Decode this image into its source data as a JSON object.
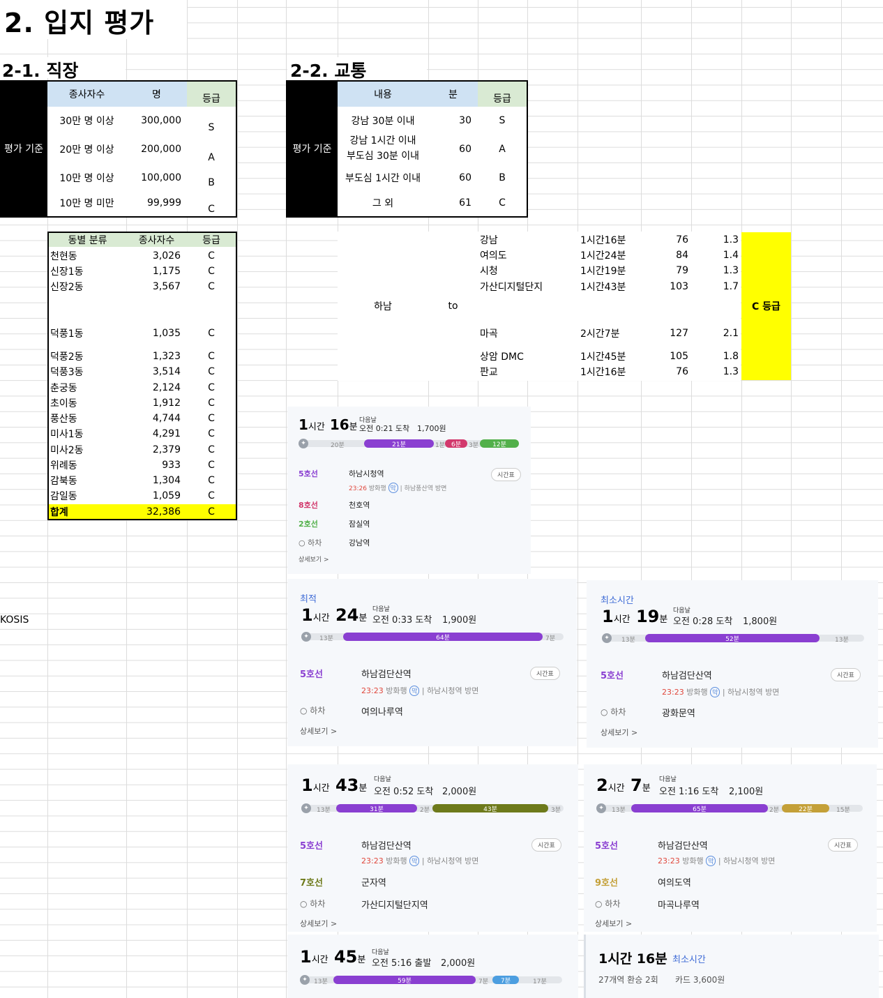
{
  "page_title": "2. 입지 평가",
  "sec1": {
    "title": "2-1. 직장",
    "criteria_label": "평가 기준",
    "headers": [
      "종사자수",
      "명",
      "등급"
    ],
    "rows": [
      {
        "desc": "30만 명 이상",
        "num": "300,000",
        "grade": "S"
      },
      {
        "desc": "20만 명 이상",
        "num": "200,000",
        "grade": "A"
      },
      {
        "desc": "10만 명 이상",
        "num": "100,000",
        "grade": "B"
      },
      {
        "desc": "10만 명 미만",
        "num": "99,999",
        "grade": "C"
      }
    ],
    "dong_headers": [
      "동별 분류",
      "종사자수",
      "등급"
    ],
    "dongs": [
      {
        "name": "천현동",
        "count": "3,026",
        "grade": "C"
      },
      {
        "name": "신장1동",
        "count": "1,175",
        "grade": "C"
      },
      {
        "name": "신장2동",
        "count": "3,567",
        "grade": "C"
      },
      {
        "name": "덕풍1동",
        "count": "1,035",
        "grade": "C"
      },
      {
        "name": "덕풍2동",
        "count": "1,323",
        "grade": "C"
      },
      {
        "name": "덕풍3동",
        "count": "3,514",
        "grade": "C"
      },
      {
        "name": "춘궁동",
        "count": "2,124",
        "grade": "C"
      },
      {
        "name": "초이동",
        "count": "1,912",
        "grade": "C"
      },
      {
        "name": "풍산동",
        "count": "4,744",
        "grade": "C"
      },
      {
        "name": "미사1동",
        "count": "4,291",
        "grade": "C"
      },
      {
        "name": "미사2동",
        "count": "2,379",
        "grade": "C"
      },
      {
        "name": "위례동",
        "count": "933",
        "grade": "C"
      },
      {
        "name": "감북동",
        "count": "1,304",
        "grade": "C"
      },
      {
        "name": "감일동",
        "count": "1,059",
        "grade": "C"
      }
    ],
    "total": {
      "name": "합계",
      "count": "32,386",
      "grade": "C"
    },
    "source": "KOSIS"
  },
  "sec2": {
    "title": "2-2. 교통",
    "criteria_label": "평가 기준",
    "headers": [
      "내용",
      "분",
      "등급"
    ],
    "rows": [
      {
        "desc1": "강남 30분 이내",
        "desc2": "",
        "num": "30",
        "grade": "S"
      },
      {
        "desc1": "강남 1시간 이내",
        "desc2": "부도심 30분 이내",
        "num": "60",
        "grade": "A"
      },
      {
        "desc1": "부도심 1시간 이내",
        "desc2": "",
        "num": "60",
        "grade": "B"
      },
      {
        "desc1": "그 외",
        "desc2": "",
        "num": "61",
        "grade": "C"
      }
    ],
    "origin": "하남",
    "to": "to",
    "dests": [
      {
        "name": "강남",
        "time": "1시간16분",
        "min": "76",
        "ratio": "1.3"
      },
      {
        "name": "여의도",
        "time": "1시간24분",
        "min": "84",
        "ratio": "1.4"
      },
      {
        "name": "시청",
        "time": "1시간19분",
        "min": "79",
        "ratio": "1.3"
      },
      {
        "name": "가산디지털단지",
        "time": "1시간43분",
        "min": "103",
        "ratio": "1.7"
      },
      {
        "name": "마곡",
        "time": "2시간7분",
        "min": "127",
        "ratio": "2.1"
      },
      {
        "name": "상암 DMC",
        "time": "1시간45분",
        "min": "105",
        "ratio": "1.8"
      },
      {
        "name": "판교",
        "time": "1시간16분",
        "min": "76",
        "ratio": "1.3"
      }
    ],
    "result": "C 등급"
  },
  "cards": {
    "c1": {
      "h": "1",
      "m": "16",
      "next": "다음날",
      "arrive": "오전 0:21 도착",
      "fare": "1,700원",
      "segs": [
        "20분",
        "21분",
        "1분",
        "6분",
        "3분",
        "12분"
      ],
      "lines": [
        {
          "l": "5호선",
          "s": "하남시청역"
        },
        {
          "l": "8호선",
          "s": "천호역"
        },
        {
          "l": "2호선",
          "s": "잠실역"
        }
      ],
      "dep": {
        "t": "23:26",
        "r": "방화행",
        "m": "막",
        "d": "하남풍산역 방면"
      },
      "off": "하차",
      "dest": "강남역",
      "tt": "시간표",
      "more": "상세보기 >"
    },
    "c2": {
      "tag": "최적",
      "h": "1",
      "m": "24",
      "next": "다음날",
      "arrive": "오전 0:33 도착",
      "fare": "1,900원",
      "segs": [
        "13분",
        "64분",
        "7분"
      ],
      "line": "5호선",
      "stn": "하남검단산역",
      "dep": {
        "t": "23:23",
        "r": "방화행",
        "m": "막",
        "d": "하남시청역 방면"
      },
      "off": "하차",
      "dest": "여의나루역",
      "tt": "시간표",
      "more": "상세보기 >"
    },
    "c3": {
      "tag": "최소시간",
      "h": "1",
      "m": "19",
      "next": "다음날",
      "arrive": "오전 0:28 도착",
      "fare": "1,800원",
      "segs": [
        "13분",
        "52분",
        "13분"
      ],
      "line": "5호선",
      "stn": "하남검단산역",
      "dep": {
        "t": "23:23",
        "r": "방화행",
        "m": "막",
        "d": "하남시청역 방면"
      },
      "off": "하차",
      "dest": "광화문역",
      "tt": "시간표",
      "more": "상세보기 >"
    },
    "c4": {
      "h": "1",
      "m": "43",
      "next": "다음날",
      "arrive": "오전 0:52 도착",
      "fare": "2,000원",
      "segs": [
        "13분",
        "31분",
        "2분",
        "43분",
        "3분"
      ],
      "line": "5호선",
      "stn": "하남검단산역",
      "line2": "7호선",
      "stn2": "군자역",
      "dep": {
        "t": "23:23",
        "r": "방화행",
        "m": "막",
        "d": "하남시청역 방면"
      },
      "off": "하차",
      "dest": "가산디지털단지역",
      "tt": "시간표",
      "more": "상세보기 >"
    },
    "c5": {
      "h": "2",
      "m": "7",
      "next": "다음날",
      "arrive": "오전 1:16 도착",
      "fare": "2,100원",
      "segs": [
        "13분",
        "65분",
        "2분",
        "22분",
        "15분"
      ],
      "line": "5호선",
      "stn": "하남검단산역",
      "line2": "9호선",
      "stn2": "여의도역",
      "dep": {
        "t": "23:23",
        "r": "방화행",
        "m": "막",
        "d": "하남시청역 방면"
      },
      "off": "하차",
      "dest": "마곡나루역",
      "tt": "시간표",
      "more": "상세보기 >"
    },
    "c6": {
      "h": "1",
      "m": "45",
      "next": "다음날",
      "arrive": "오전 5:16 출발",
      "fare": "2,000원",
      "segs": [
        "13분",
        "59분",
        "7분",
        "7분",
        "17분"
      ]
    },
    "c7": {
      "time": "1시간 16분",
      "tag": "최소시간",
      "detail": "27개역 환승 2회",
      "card": "카드 3,600원"
    }
  },
  "unit": {
    "h": "시간",
    "m": "분"
  },
  "colors": {
    "header_blue": "#cfe2f3",
    "header_green": "#d9ead3",
    "highlight": "#ffff00",
    "line5": "#8a3fd1",
    "line8": "#d2386c",
    "line2": "#52b04a",
    "line7": "#6e7a1b",
    "line9": "#c4a038"
  }
}
